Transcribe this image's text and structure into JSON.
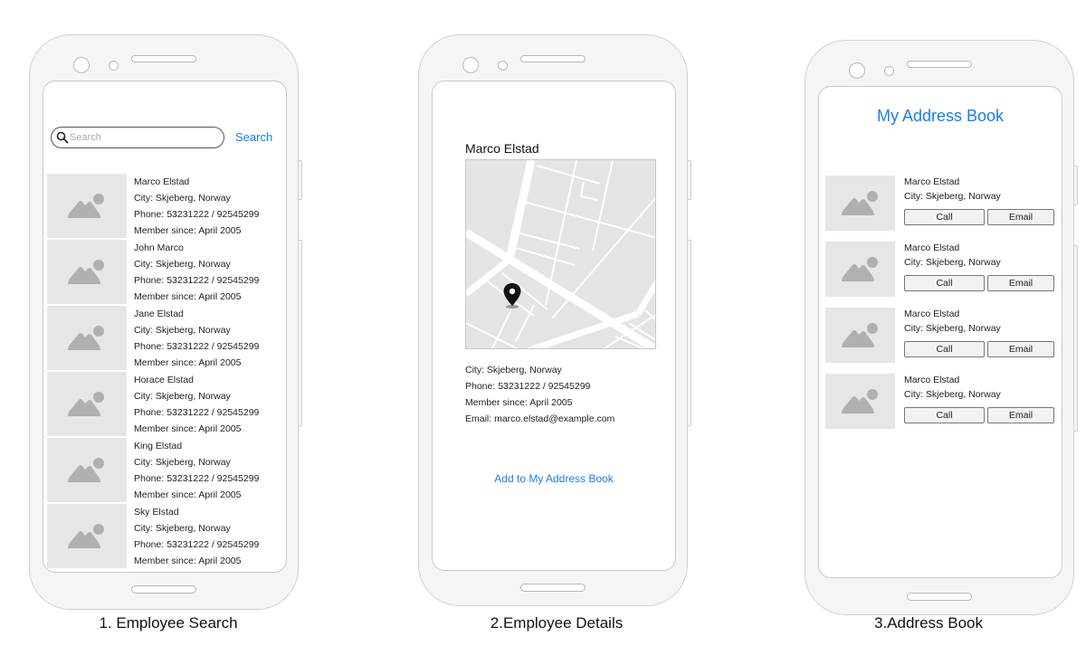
{
  "screens": [
    {
      "id": "employee-search",
      "caption": "1. Employee Search",
      "search": {
        "placeholder": "Search",
        "value": "",
        "button_label": "Search",
        "icon": "search-icon"
      },
      "employees": [
        {
          "name": "Marco Elstad",
          "city": "City: Skjeberg, Norway",
          "phone": "Phone: 53231222 / 92545299",
          "member_since": "Member since: April 2005"
        },
        {
          "name": "John Marco",
          "city": "City: Skjeberg, Norway",
          "phone": "Phone: 53231222 / 92545299",
          "member_since": "Member since: April 2005"
        },
        {
          "name": "Jane Elstad",
          "city": "City: Skjeberg, Norway",
          "phone": "Phone: 53231222 / 92545299",
          "member_since": "Member since: April 2005"
        },
        {
          "name": "Horace Elstad",
          "city": "City: Skjeberg, Norway",
          "phone": "Phone: 53231222 / 92545299",
          "member_since": "Member since: April 2005"
        },
        {
          "name": "King Elstad",
          "city": "City: Skjeberg, Norway",
          "phone": "Phone: 53231222 / 92545299",
          "member_since": "Member since: April 2005"
        },
        {
          "name": "Sky Elstad",
          "city": "City: Skjeberg, Norway",
          "phone": "Phone: 53231222 / 92545299",
          "member_since": "Member since: April 2005"
        }
      ]
    },
    {
      "id": "employee-details",
      "caption": "2.Employee Details",
      "name": "Marco Elstad",
      "map_icon": "map-pin-icon",
      "details": {
        "city": "City: Skjeberg, Norway",
        "phone": "Phone: 53231222 / 92545299",
        "member_since": "Member since: April 2005",
        "email": "Email: marco.elstad@example.com"
      },
      "add_button_label": "Add to My Address Book"
    },
    {
      "id": "address-book",
      "caption": "3.Address Book",
      "title": "My Address Book",
      "contacts": [
        {
          "name": "Marco Elstad",
          "city": "City: Skjeberg, Norway",
          "call_label": "Call",
          "email_label": "Email"
        },
        {
          "name": "Marco Elstad",
          "city": "City: Skjeberg, Norway",
          "call_label": "Call",
          "email_label": "Email"
        },
        {
          "name": "Marco Elstad",
          "city": "City: Skjeberg, Norway",
          "call_label": "Call",
          "email_label": "Email"
        },
        {
          "name": "Marco Elstad",
          "city": "City: Skjeberg, Norway",
          "call_label": "Call",
          "email_label": "Email"
        }
      ]
    }
  ],
  "colors": {
    "accent": "#1a7cf0",
    "phone_frame": "#f5f5f5",
    "placeholder_bg": "#e6e6e6",
    "placeholder_icon": "#b0b0b0",
    "map_bg": "#e4e4e4"
  }
}
